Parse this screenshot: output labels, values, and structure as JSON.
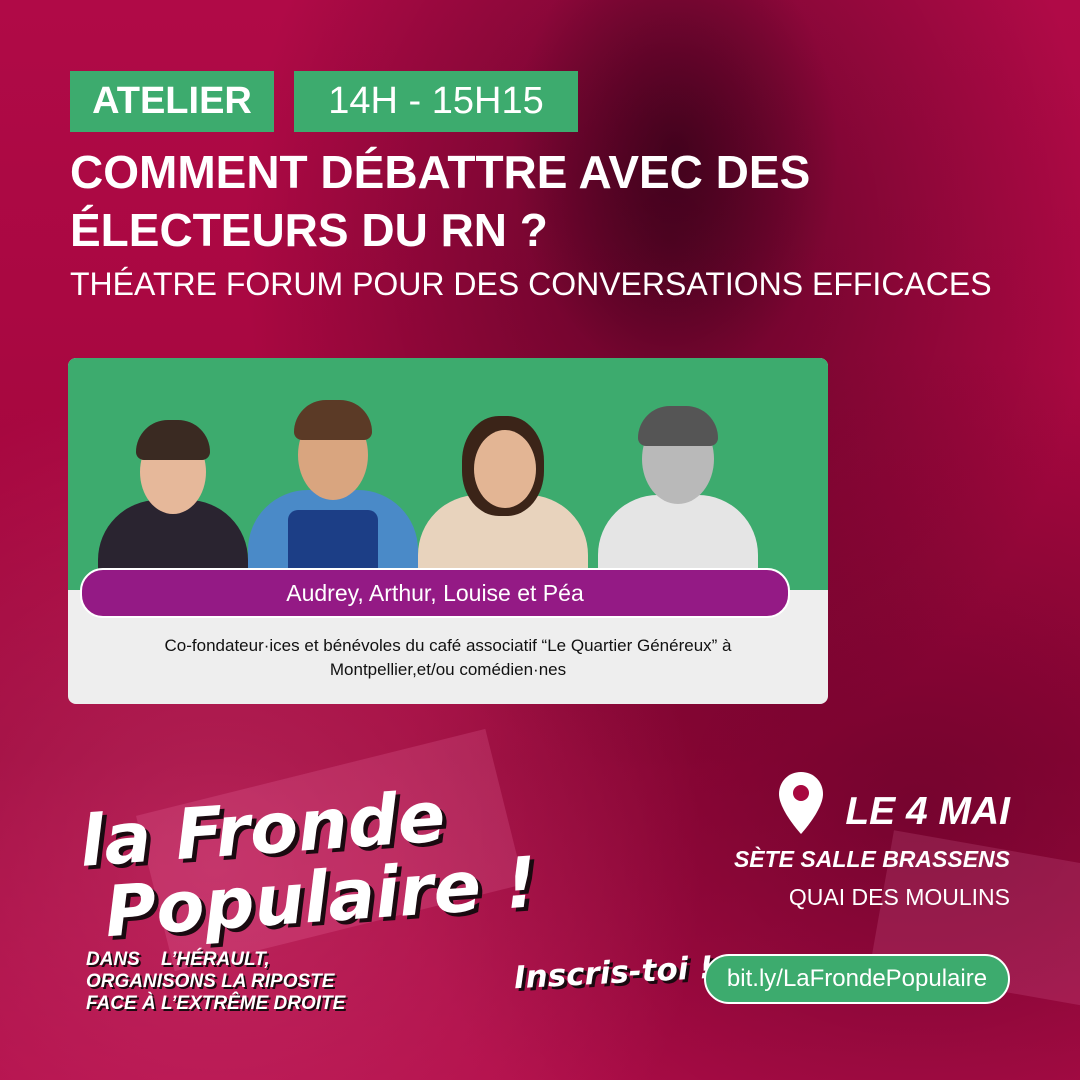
{
  "header": {
    "tag_label": "ATELIER",
    "time_label": "14H - 15H15",
    "title_line1": "COMMENT DÉBATTRE AVEC DES",
    "title_line2": "ÉLECTEURS DU RN ?",
    "subtitle": "THÉATRE FORUM POUR DES CONVERSATIONS EFFICACES"
  },
  "speakers": {
    "names": "Audrey,  Arthur,  Louise et Péa",
    "description_line1": "Co-fondateur·ices et bénévoles du café associatif “Le Quartier Généreux” à",
    "description_line2": "Montpellier,et/ou  comédien·nes"
  },
  "brand": {
    "line1": "la Fronde",
    "line2": "Populaire !",
    "slogan_line1": "DANS    L’HÉRAULT,",
    "slogan_line2": "ORGANISONS LA RIPOSTE",
    "slogan_line3": "FACE À L’EXTRÊME DROITE"
  },
  "event": {
    "icon": "location-pin-icon",
    "date": "LE 4 MAI",
    "venue": "SÈTE SALLE BRASSENS",
    "address": "QUAI DES MOULINS"
  },
  "cta": {
    "label": "Inscris-toi !",
    "link": "bit.ly/LaFrondePopulaire"
  },
  "colors": {
    "background": "#a8083f",
    "accent_green": "#3dab6e",
    "names_purple": "#941a85"
  }
}
